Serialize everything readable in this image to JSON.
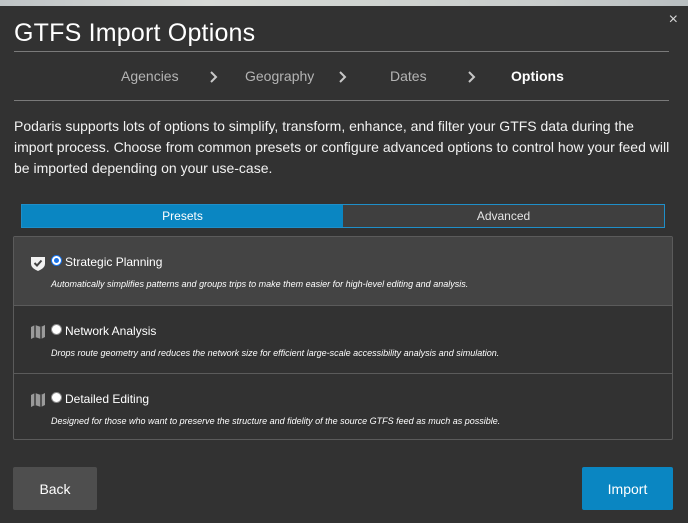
{
  "dialog": {
    "title": "GTFS Import Options",
    "close_label": "×"
  },
  "steps": [
    {
      "label": "Agencies",
      "active": false
    },
    {
      "label": "Geography",
      "active": false
    },
    {
      "label": "Dates",
      "active": false
    },
    {
      "label": "Options",
      "active": true
    }
  ],
  "description": "Podaris supports lots of options to simplify, transform, enhance, and filter your GTFS data during the import process. Choose from common presets or configure advanced options to control how your feed will be imported depending on your use-case.",
  "tabs": [
    {
      "label": "Presets",
      "active": true
    },
    {
      "label": "Advanced",
      "active": false
    }
  ],
  "presets": [
    {
      "title": "Strategic Planning",
      "description": "Automatically simplifies patterns and groups trips to make them easier for high-level editing and analysis.",
      "selected": true,
      "icon": "shield-check-icon"
    },
    {
      "title": "Network Analysis",
      "description": "Drops route geometry and reduces the network size for efficient large-scale accessibility analysis and simulation.",
      "selected": false,
      "icon": "map-icon"
    },
    {
      "title": "Detailed Editing",
      "description": "Designed for those who want to preserve the structure and fidelity of the source GTFS feed as much as possible.",
      "selected": false,
      "icon": "map-icon"
    }
  ],
  "buttons": {
    "back_label": "Back",
    "import_label": "Import"
  },
  "colors": {
    "accent": "#0a86c2",
    "background": "#323232"
  }
}
